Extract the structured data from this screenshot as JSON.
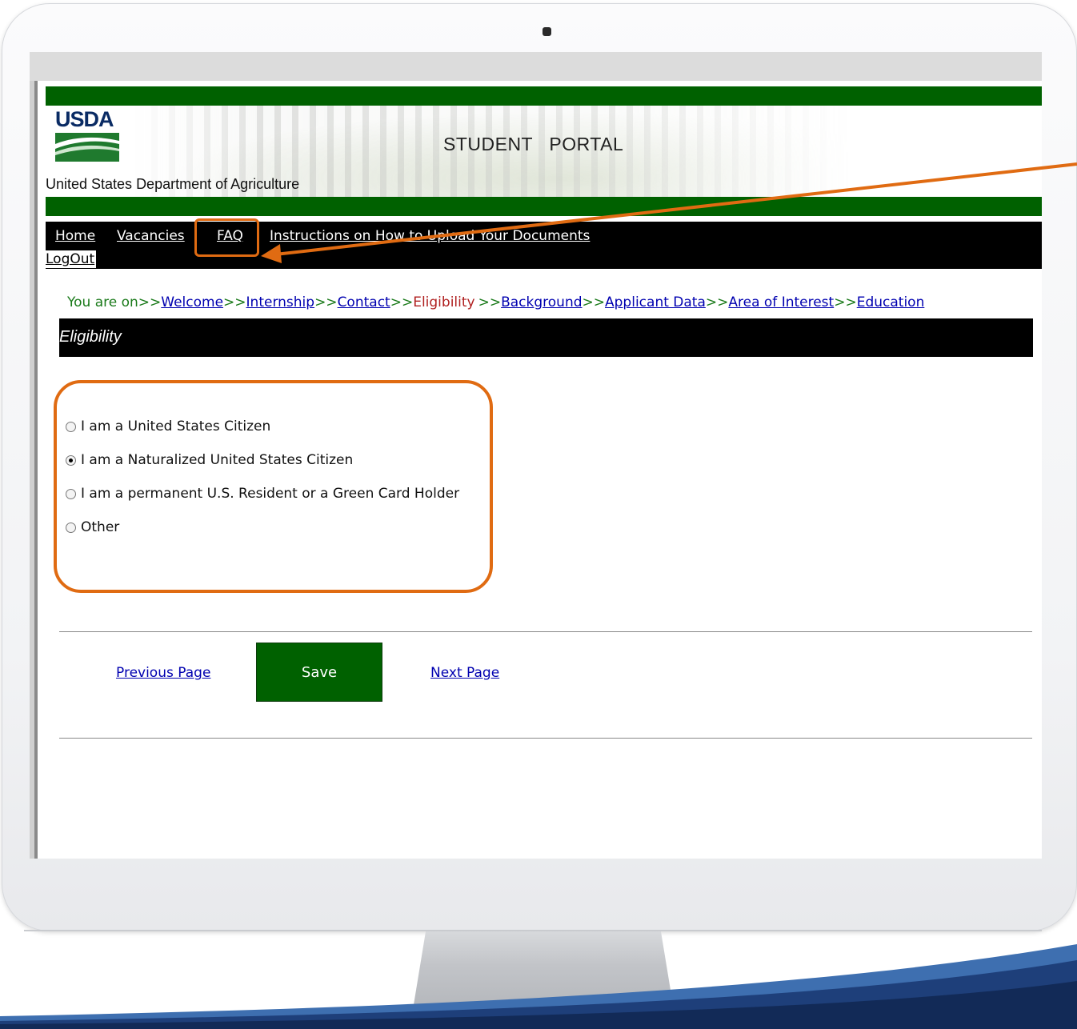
{
  "header": {
    "logo_text": "USDA",
    "portal_title": "STUDENT   PORTAL",
    "department": "United States Department of Agriculture"
  },
  "nav": {
    "home": "Home",
    "vacancies": "Vacancies",
    "faq": "FAQ",
    "instructions": "Instructions on How to Upload Your Documents",
    "logout": "LogOut"
  },
  "breadcrumb": {
    "lead": "You are on>>",
    "steps": [
      "Welcome",
      "Internship",
      "Contact",
      "Eligibility",
      "Background",
      "Applicant Data",
      "Area of Interest",
      "Education"
    ],
    "current": "Eligibility",
    "sep": ">>"
  },
  "section": {
    "title": "Eligibility"
  },
  "eligibility": {
    "options": [
      {
        "label": "I am a United States Citizen",
        "checked": false
      },
      {
        "label": "I am a Naturalized United States Citizen",
        "checked": true
      },
      {
        "label": "I am a permanent U.S. Resident or a Green Card Holder",
        "checked": false
      },
      {
        "label": "Other",
        "checked": false
      }
    ]
  },
  "actions": {
    "previous": "Previous Page",
    "save": "Save",
    "next": "Next Page"
  },
  "colors": {
    "brand_green": "#006100",
    "callout_orange": "#e06b12",
    "link_blue": "#0000b0"
  }
}
